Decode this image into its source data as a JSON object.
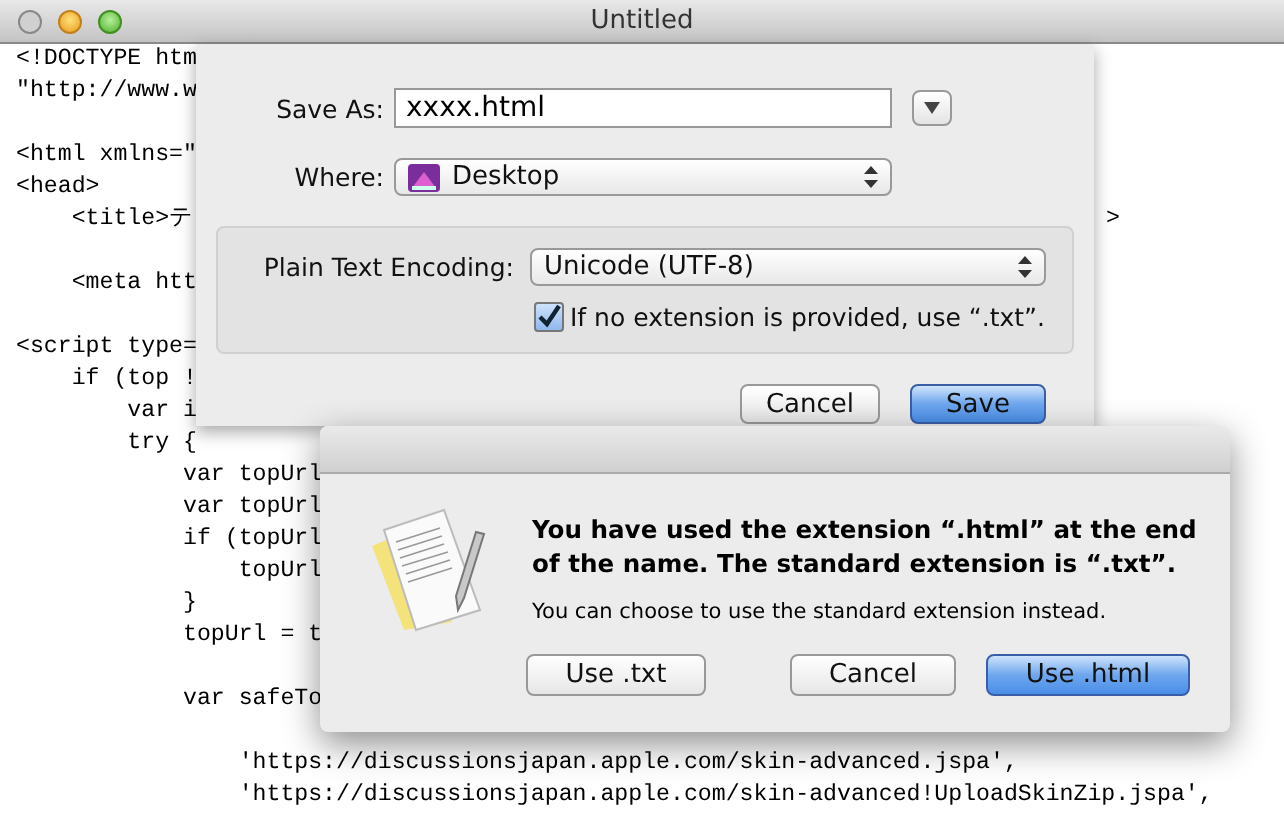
{
  "window": {
    "title": "Untitled"
  },
  "editor": {
    "lines": [
      {
        "kind": "code",
        "text": "<!DOCTYPE htm"
      },
      {
        "kind": "code",
        "text": "\"http://www.w"
      },
      {
        "kind": "blank"
      },
      {
        "kind": "code",
        "text": "<html xmlns=\""
      },
      {
        "kind": "code",
        "text": "<head>"
      },
      {
        "kind": "code",
        "text": "    <title>テ",
        "tail": ">"
      },
      {
        "kind": "blank"
      },
      {
        "kind": "code",
        "text": "    <meta htt"
      },
      {
        "kind": "blank"
      },
      {
        "kind": "code",
        "text": "<script type="
      },
      {
        "kind": "code",
        "text": "    if (top !"
      },
      {
        "kind": "code",
        "text": "        var i"
      },
      {
        "kind": "code",
        "text": "        try {"
      },
      {
        "kind": "code",
        "text": "            var topUrl"
      },
      {
        "kind": "code",
        "text": "            var topUrl"
      },
      {
        "kind": "code",
        "text": "            if (topUrl"
      },
      {
        "kind": "code",
        "text": "                topUrl"
      },
      {
        "kind": "code",
        "text": "            }"
      },
      {
        "kind": "code",
        "text": "            topUrl = t"
      },
      {
        "kind": "blank"
      },
      {
        "kind": "code",
        "text": "            var safeTo"
      },
      {
        "kind": "blank"
      },
      {
        "kind": "code",
        "text": "                'https://discussionsjapan.apple.com/skin-advanced.jspa',"
      },
      {
        "kind": "code",
        "text": "                'https://discussionsjapan.apple.com/skin-advanced!UploadSkinZip.jspa',"
      }
    ]
  },
  "save_sheet": {
    "save_as": {
      "label": "Save As:",
      "value": "xxxx.html"
    },
    "where": {
      "label": "Where:",
      "value": "Desktop"
    },
    "encoding": {
      "label": "Plain Text Encoding:",
      "value": "Unicode (UTF-8)"
    },
    "extension_option": {
      "label": "If no extension is provided, use “.txt”.",
      "checked": true
    },
    "buttons": [
      {
        "label": "Cancel",
        "default": false
      },
      {
        "label": "Save",
        "default": true
      }
    ]
  },
  "alert": {
    "message": "You have used the extension “.html” at the end of the name. The standard extension is “.txt”.",
    "informative": "You can choose to use the standard extension instead.",
    "buttons": [
      {
        "label": "Use .txt",
        "default": false
      },
      {
        "label": "Cancel",
        "default": false
      },
      {
        "label": "Use .html",
        "default": true
      }
    ]
  }
}
